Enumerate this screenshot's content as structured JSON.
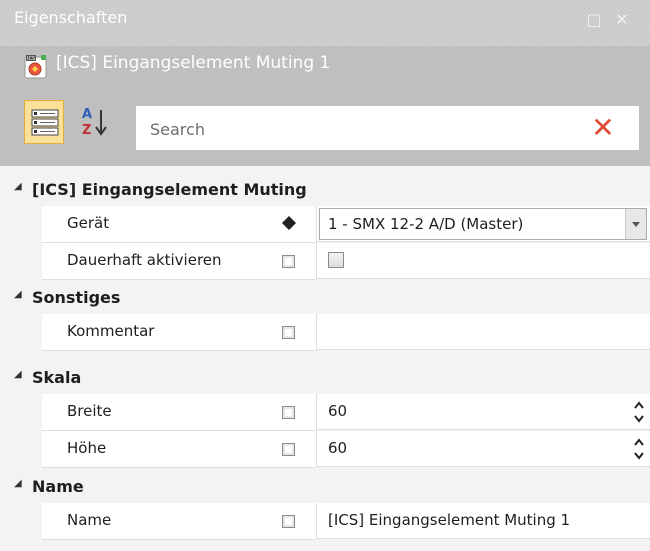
{
  "panel": {
    "title": "Eigenschaften",
    "element_name": "[ICS] Eingangselement Muting 1"
  },
  "icons": {
    "restore": "restore-window-icon",
    "close": "close-icon",
    "element": "ics-element-icon",
    "categorized": "categorized-view-icon",
    "alphabetical": "sort-az-icon",
    "clear": "clear-search-icon"
  },
  "window_buttons": {
    "restore_glyph": "□",
    "close_glyph": "✕"
  },
  "search": {
    "placeholder": "Search",
    "value": "",
    "clear_glyph": "✕"
  },
  "grid": {
    "categories": [
      {
        "name": "[ICS] Eingangselement Muting",
        "properties": [
          {
            "name": "Gerät",
            "value": "1 - SMX 12-2 A/D (Master)"
          },
          {
            "name": "Dauerhaft aktivieren",
            "value": ""
          }
        ]
      },
      {
        "name": "Sonstiges",
        "properties": [
          {
            "name": "Kommentar",
            "value": ""
          }
        ]
      },
      {
        "name": "Skala",
        "properties": [
          {
            "name": "Breite",
            "value": "60"
          },
          {
            "name": "Höhe",
            "value": "60"
          }
        ]
      },
      {
        "name": "Name",
        "properties": [
          {
            "name": "Name",
            "value": "[ICS] Eingangselement Muting 1"
          }
        ]
      }
    ]
  },
  "colors": {
    "titlebar": "#c9c9c9",
    "header": "#bfbfbf",
    "selected_button": "#fbe09a",
    "clear_icon": "#e04a36"
  }
}
